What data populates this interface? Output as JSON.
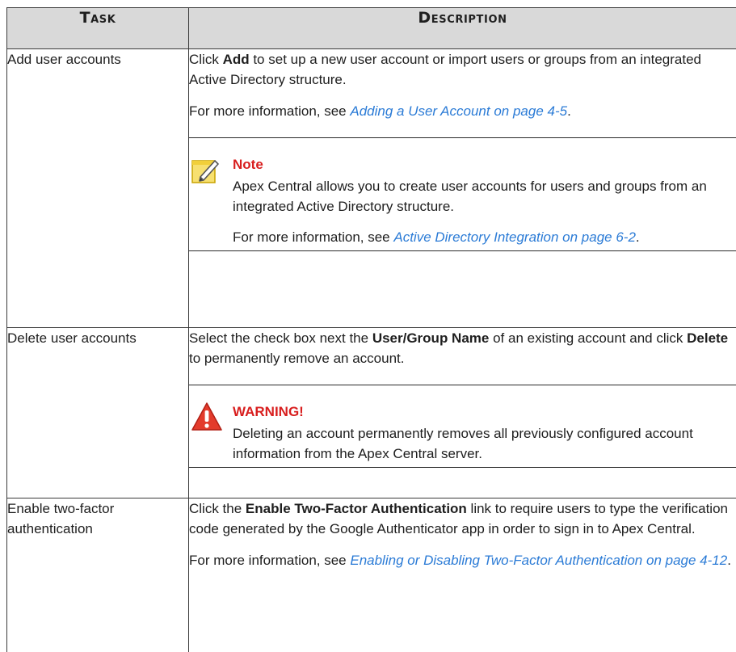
{
  "table": {
    "headers": {
      "task": "Task",
      "description": "Description"
    },
    "rows": [
      {
        "task": "Add user accounts",
        "desc1_pre": "Click ",
        "desc1_bold": "Add",
        "desc1_post": " to set up a new user account or import users or groups from an integrated Active Directory structure.",
        "more_pre": "For more information, see ",
        "more_link": "Adding a User Account on page 4-5",
        "more_post": ".",
        "callout": {
          "title": "Note",
          "body": "Apex Central allows you to create user accounts for users and groups from an integrated Active Directory structure.",
          "more_pre": "For more information, see ",
          "more_link": "Active Directory Integration on page 6-2",
          "more_post": "."
        }
      },
      {
        "task": "Delete user accounts",
        "desc1_pre": "Select the check box next the ",
        "desc1_bold": "User/Group Name",
        "desc1_mid": " of an existing account and click ",
        "desc1_bold2": "Delete",
        "desc1_post": " to permanently remove an account.",
        "callout": {
          "title": "WARNING!",
          "body": "Deleting an account permanently removes all previously configured account information from the Apex Central server."
        }
      },
      {
        "task": "Enable two-factor authentication",
        "desc1_pre": "Click the ",
        "desc1_bold": "Enable Two-Factor Authentication",
        "desc1_post": " link to require users to type the verification code generated by the Google Authenticator app in order to sign in to Apex Central.",
        "more_pre": "For more information, see ",
        "more_link": "Enabling or Disabling Two-Factor Authentication on page 4-12",
        "more_post": "."
      }
    ]
  },
  "icons": {
    "note": "note-pencil-icon",
    "warning": "warning-exclamation-icon"
  },
  "colors": {
    "header_bg": "#d9d9d9",
    "link": "#2b7bd6",
    "alert_title": "#d81e1e"
  }
}
